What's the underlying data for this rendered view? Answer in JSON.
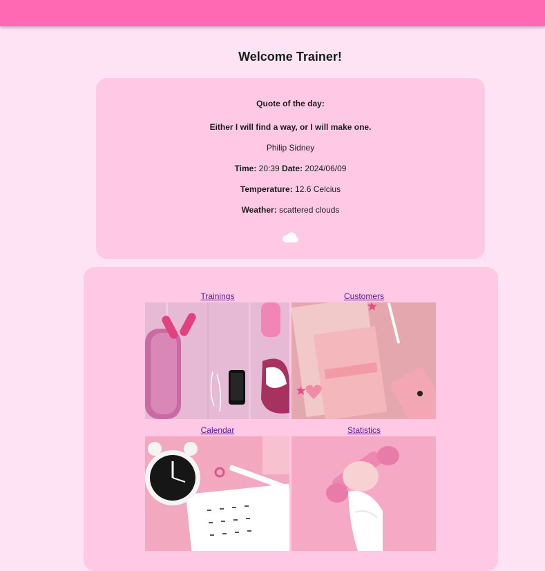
{
  "header": {},
  "page": {
    "title": "Welcome Trainer!"
  },
  "quote": {
    "heading": "Quote of the day:",
    "text": "Either I will find a way, or I will make one.",
    "author": "Philip Sidney",
    "time_label": "Time:",
    "time_value": "20:39",
    "date_label": "Date:",
    "date_value": "2024/06/09",
    "temp_label": "Temperature:",
    "temp_value": "12.6 Celcius",
    "weather_label": "Weather:",
    "weather_value": "scattered clouds",
    "weather_icon": "cloud-icon"
  },
  "tiles": [
    {
      "label": "Trainings",
      "image": "fitness-gear-photo"
    },
    {
      "label": "Customers",
      "image": "notebook-phone-photo"
    },
    {
      "label": "Calendar",
      "image": "alarm-clock-calendar-photo"
    },
    {
      "label": "Statistics",
      "image": "dumbbell-hand-photo"
    }
  ],
  "colors": {
    "header": "#ff69b4",
    "background": "#fde3f3",
    "card": "#ffc9e6",
    "link": "#551a8b"
  }
}
